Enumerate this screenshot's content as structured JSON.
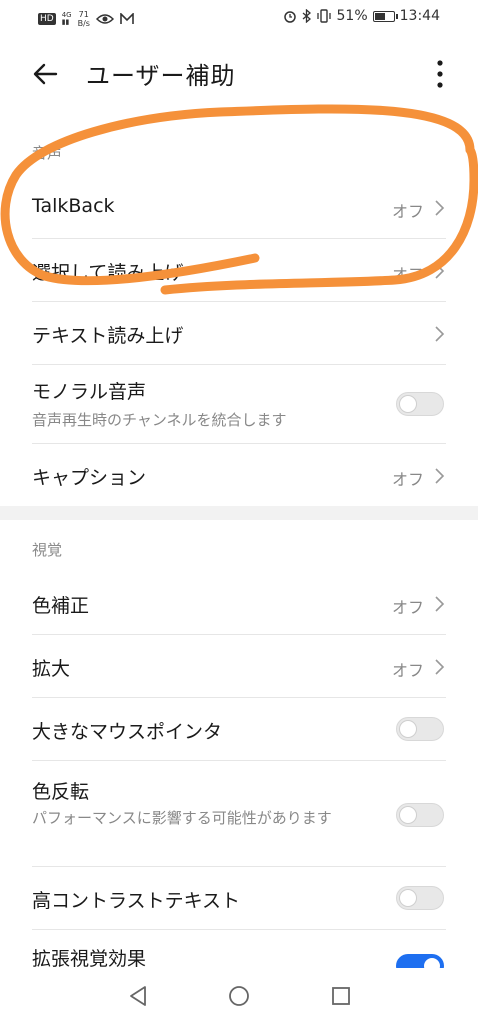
{
  "status_bar": {
    "hd_badge": "HD",
    "network": "4G",
    "speed_value": "71",
    "speed_unit": "B/s",
    "battery_percent": "51%",
    "time": "13:44"
  },
  "header": {
    "title": "ユーザー補助"
  },
  "sections": {
    "audio_label": "音声",
    "vision_label": "視覚"
  },
  "audio_items": {
    "talkback": {
      "label": "TalkBack",
      "value": "オフ"
    },
    "select_to_speak": {
      "label": "選択して読み上げ",
      "value": "オフ"
    },
    "tts": {
      "label": "テキスト読み上げ"
    },
    "mono_audio": {
      "label": "モノラル音声",
      "sub": "音声再生時のチャンネルを統合します",
      "enabled": false
    },
    "captions": {
      "label": "キャプション",
      "value": "オフ"
    }
  },
  "vision_items": {
    "color_correction": {
      "label": "色補正",
      "value": "オフ"
    },
    "magnification": {
      "label": "拡大",
      "value": "オフ"
    },
    "large_pointer": {
      "label": "大きなマウスポインタ",
      "enabled": false
    },
    "color_inversion": {
      "label": "色反転",
      "sub": "パフォーマンスに影響する可能性があります",
      "enabled": false
    },
    "high_contrast": {
      "label": "高コントラストテキスト",
      "enabled": false
    },
    "extended_visual": {
      "label": "拡張視覚効果",
      "enabled": true
    }
  },
  "colors": {
    "annotation": "#f5913a",
    "accent": "#1e6ff0"
  }
}
